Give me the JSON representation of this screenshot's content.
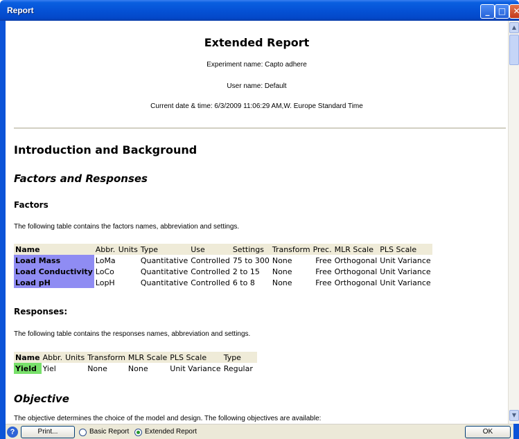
{
  "window": {
    "title": "Report",
    "minimize_glyph": "_",
    "maximize_glyph": "□",
    "close_glyph": "✕"
  },
  "report": {
    "title": "Extended Report",
    "experiment": "Experiment name: Capto adhere",
    "user": "User name: Default",
    "datetime": "Current date & time: 6/3/2009 11:06:29 AM,W. Europe Standard Time",
    "intro_heading": "Introduction and Background",
    "factors_responses_heading": "Factors and Responses",
    "factors_heading": "Factors",
    "factors_desc": "The following table contains the factors names, abbreviation and settings.",
    "responses_heading": "Responses:",
    "responses_desc": "The following table contains the responses names, abbreviation and settings.",
    "objective_heading": "Objective",
    "objective_desc": "The objective determines the choice of the model and design. The following objectives are available:"
  },
  "factors_table": {
    "headers": {
      "name": "Name",
      "abbr": "Abbr.",
      "units": "Units",
      "type": "Type",
      "use": "Use",
      "settings": "Settings",
      "transform": "Transform",
      "prec": "Prec.",
      "mlr": "MLR Scale",
      "pls": "PLS Scale"
    },
    "rows": [
      {
        "name": "Load Mass",
        "abbr": "LoMa",
        "units": "",
        "type": "Quantitative",
        "use": "Controlled",
        "settings": "75 to 300",
        "transform": "None",
        "prec": "Free",
        "mlr": "Orthogonal",
        "pls": "Unit Variance"
      },
      {
        "name": "Load Conductivity",
        "abbr": "LoCo",
        "units": "",
        "type": "Quantitative",
        "use": "Controlled",
        "settings": "2 to 15",
        "transform": "None",
        "prec": "Free",
        "mlr": "Orthogonal",
        "pls": "Unit Variance"
      },
      {
        "name": "Load pH",
        "abbr": "LopH",
        "units": "",
        "type": "Quantitative",
        "use": "Controlled",
        "settings": "6 to 8",
        "transform": "None",
        "prec": "Free",
        "mlr": "Orthogonal",
        "pls": "Unit Variance"
      }
    ]
  },
  "responses_table": {
    "headers": {
      "name": "Name",
      "abbr": "Abbr.",
      "units": "Units",
      "transform": "Transform",
      "mlr": "MLR Scale",
      "pls": "PLS Scale",
      "type": "Type"
    },
    "rows": [
      {
        "name": "Yield",
        "abbr": "Yiel",
        "units": "",
        "transform": "None",
        "mlr": "None",
        "pls": "Unit Variance",
        "type": "Regular"
      }
    ]
  },
  "bottom": {
    "help_glyph": "?",
    "print_label": "Print...",
    "basic_label": "Basic Report",
    "extended_label": "Extended Report",
    "selected_report": "Extended Report",
    "ok_label": "OK"
  },
  "colors": {
    "title_bar": "#0552d6",
    "factor_name_bg": "#8f8cf3",
    "response_name_bg": "#78e06a",
    "header_bg": "#efebd8"
  },
  "icons": [
    "help-icon",
    "minimize-icon",
    "maximize-icon",
    "close-icon",
    "scroll-up-icon",
    "scroll-down-icon"
  ]
}
